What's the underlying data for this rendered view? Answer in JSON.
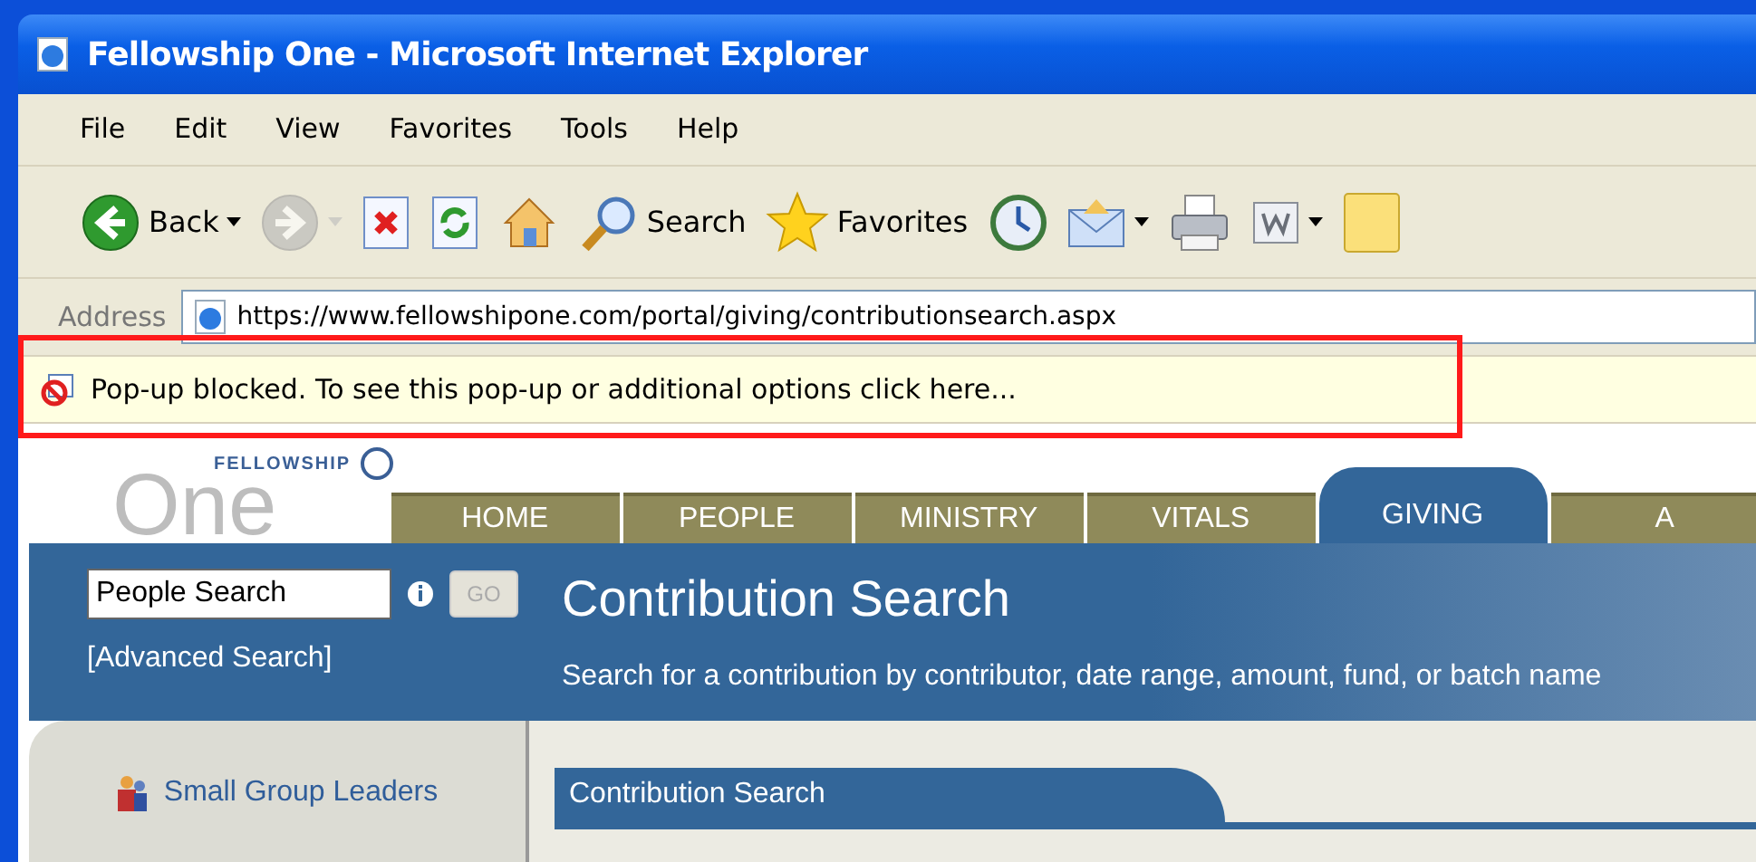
{
  "window": {
    "title": "Fellowship One - Microsoft Internet Explorer"
  },
  "menu": [
    "File",
    "Edit",
    "View",
    "Favorites",
    "Tools",
    "Help"
  ],
  "toolbar": [
    {
      "kind": "back",
      "label": "Back",
      "dropdown": true,
      "disabled": false
    },
    {
      "kind": "forward",
      "dropdown": true,
      "disabled": true
    },
    {
      "kind": "stop",
      "dropdown": false,
      "disabled": false
    },
    {
      "kind": "refresh",
      "dropdown": false,
      "disabled": false
    },
    {
      "kind": "home",
      "dropdown": false,
      "disabled": false
    },
    {
      "kind": "search",
      "label": "Search",
      "dropdown": false,
      "disabled": false
    },
    {
      "kind": "favorites",
      "label": "Favorites",
      "dropdown": false,
      "disabled": false
    },
    {
      "kind": "history",
      "dropdown": false,
      "disabled": false
    },
    {
      "kind": "mail",
      "dropdown": true,
      "disabled": false
    },
    {
      "kind": "print",
      "dropdown": false,
      "disabled": false
    },
    {
      "kind": "word",
      "dropdown": true,
      "disabled": false
    },
    {
      "kind": "note",
      "dropdown": false,
      "disabled": false
    }
  ],
  "address": {
    "label": "Address",
    "url": "https://www.fellowshipone.com/portal/giving/contributionsearch.aspx"
  },
  "info_bar": {
    "text": "Pop-up blocked. To see this pop-up or additional options click here..."
  },
  "site": {
    "logo_top": "FELLOWSHIP",
    "logo_main": "One",
    "tabs": [
      {
        "label": "HOME",
        "selected": false
      },
      {
        "label": "PEOPLE",
        "selected": false
      },
      {
        "label": "MINISTRY",
        "selected": false
      },
      {
        "label": "VITALS",
        "selected": false
      },
      {
        "label": "GIVING",
        "selected": true
      },
      {
        "label": "A",
        "selected": false
      }
    ],
    "search": {
      "value": "People Search",
      "button": "GO",
      "advanced": "[Advanced Search]"
    },
    "page_title": "Contribution Search",
    "description": "Search for a contribution by contributor, date range, amount, fund, or batch name",
    "sidebar": [
      {
        "label": "Small Group Leaders"
      }
    ],
    "panel": {
      "title": "Contribution Search"
    }
  }
}
